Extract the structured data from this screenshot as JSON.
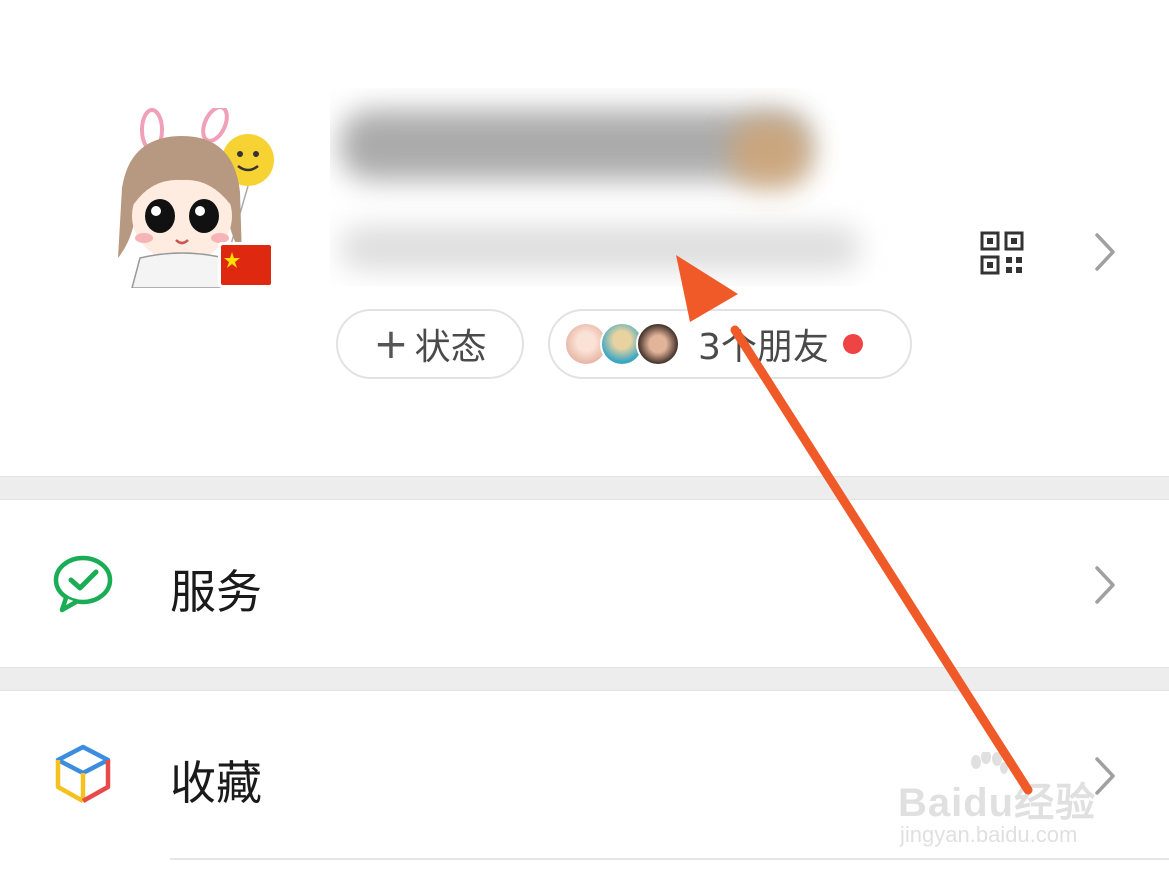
{
  "profile": {
    "status_button": {
      "plus": "+",
      "label": "状态"
    },
    "friends_button": {
      "label": "3个朋友"
    }
  },
  "menu": [
    {
      "label": "服务",
      "icon": "wechat-pay-icon"
    },
    {
      "label": "收藏",
      "icon": "favorites-cube-icon"
    }
  ],
  "colors": {
    "accent_green": "#07c160",
    "red_dot": "#f04444",
    "annotation_arrow": "#f05a28",
    "divider": "#ededed"
  },
  "watermark": {
    "brand": "Baidu经验",
    "url": "jingyan.baidu.com"
  }
}
